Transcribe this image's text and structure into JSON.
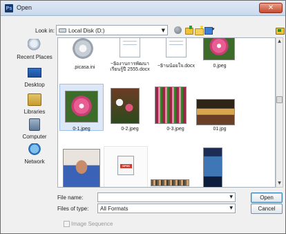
{
  "window": {
    "title": "Open",
    "app_icon": "Ps"
  },
  "toolbar": {
    "look_in_label": "Look in:",
    "look_in_value": "Local Disk (D:)"
  },
  "places": [
    {
      "label": "Recent Places",
      "icon": "recent-places-icon"
    },
    {
      "label": "Desktop",
      "icon": "desktop-icon"
    },
    {
      "label": "Libraries",
      "icon": "libraries-icon"
    },
    {
      "label": "Computer",
      "icon": "computer-icon"
    },
    {
      "label": "Network",
      "icon": "network-icon"
    }
  ],
  "files": [
    {
      "name": ".picasa.ini",
      "kind": "settings"
    },
    {
      "name": "~$องานการพัฒนา\nเรียนรู้ปี 2555.docx",
      "kind": "document"
    },
    {
      "name": "~$านน้อยใจ.docx",
      "kind": "document"
    },
    {
      "name": "0.jpeg",
      "kind": "image"
    },
    {
      "name": "0-1.jpeg",
      "kind": "image",
      "selected": true
    },
    {
      "name": "0-2.jpeg",
      "kind": "image"
    },
    {
      "name": "0-3.jpeg",
      "kind": "image"
    },
    {
      "name": "01.jpg",
      "kind": "image"
    },
    {
      "name": "",
      "kind": "image"
    },
    {
      "name": "",
      "kind": "spss"
    },
    {
      "name": "",
      "kind": "image"
    },
    {
      "name": "",
      "kind": "image"
    }
  ],
  "footer": {
    "file_name_label": "File name:",
    "file_name_value": "",
    "files_of_type_label": "Files of type:",
    "files_of_type_value": "All Formats",
    "open_label": "Open",
    "cancel_label": "Cancel",
    "image_sequence_label": "Image Sequence"
  },
  "colors": {
    "accent": "#3c7fb1",
    "selection": "#dce8f7"
  }
}
